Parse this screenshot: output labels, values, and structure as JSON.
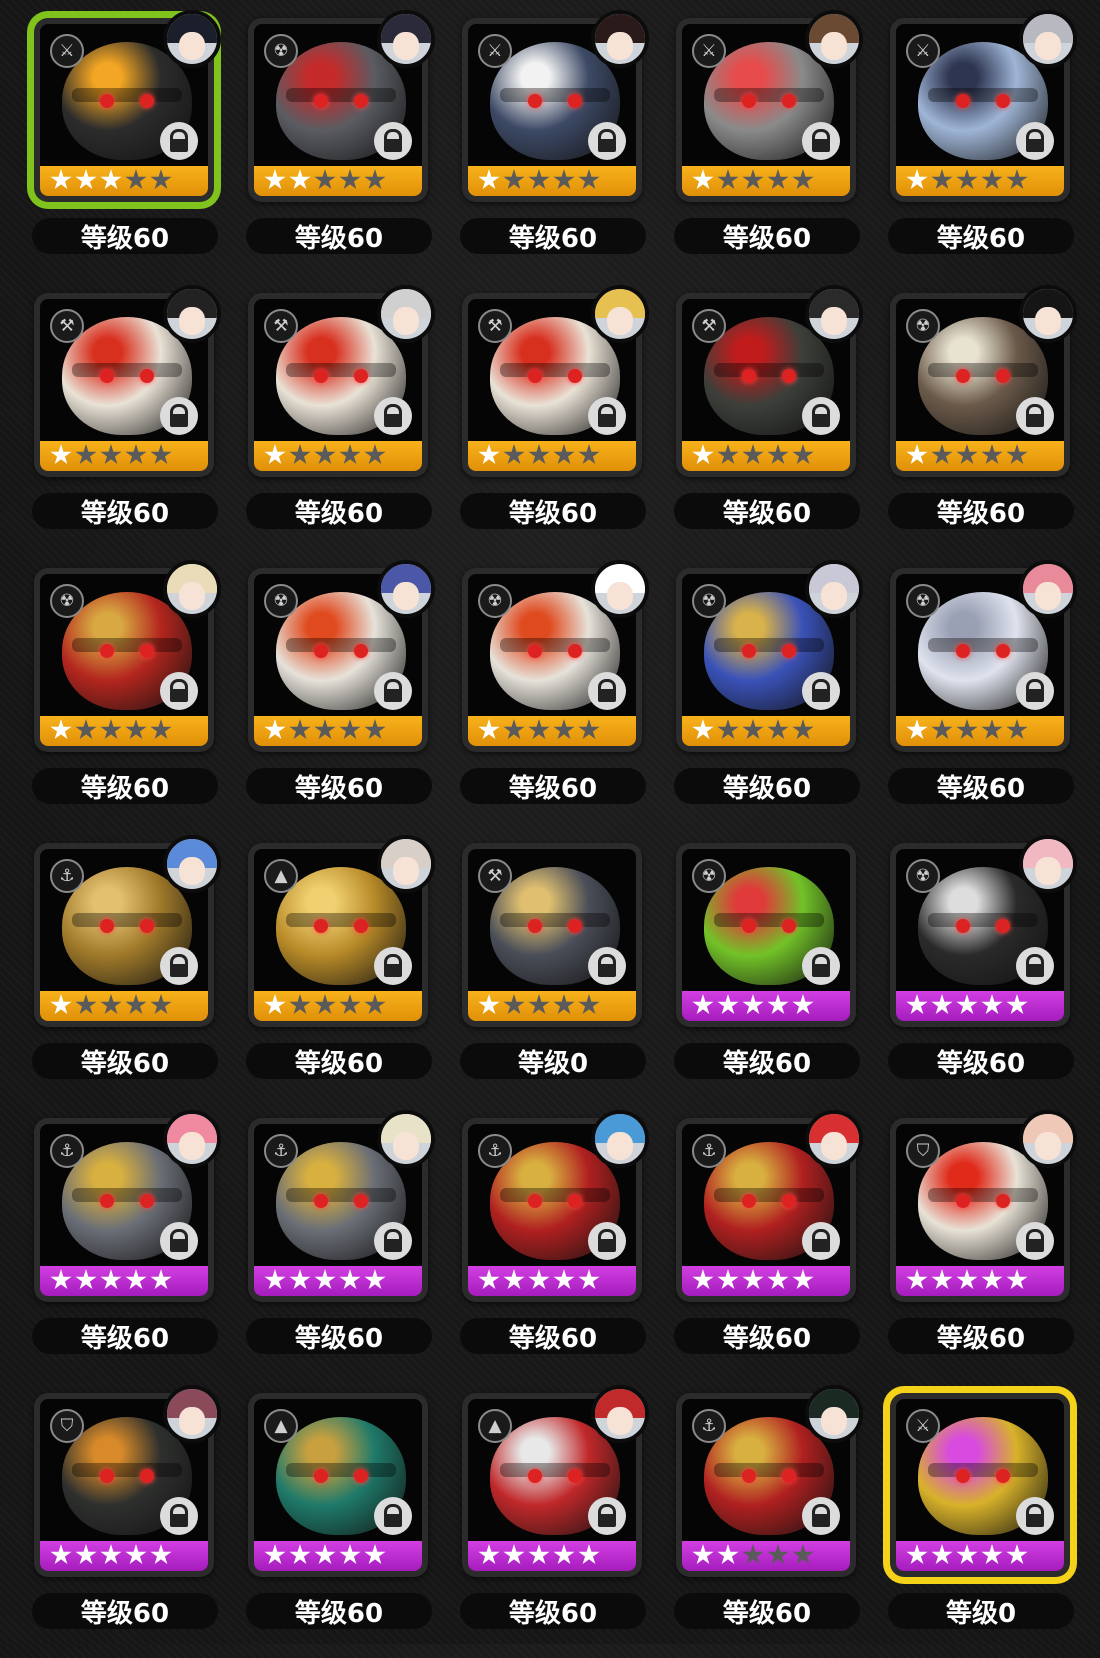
{
  "screen": "bangboo-inventory",
  "colors": {
    "rank_a": "#f8b21b",
    "rank_s": "#d23fe3",
    "selected_green": "#7fc31c",
    "selected_yellow": "#f5d21a",
    "level_pill": "#0b0b0b"
  },
  "bangboos": [
    {
      "level": "等级60",
      "rank": "a",
      "stars": 3,
      "selected": "green",
      "type_icon": "crossed-swords-icon",
      "avatar_hair": "#1b1f2b",
      "body": "#2c2c2c",
      "accent": "#f3a623"
    },
    {
      "level": "等级60",
      "rank": "a",
      "stars": 2,
      "selected": "",
      "type_icon": "radiation-icon",
      "avatar_hair": "#2a2a3a",
      "body": "#5a5c62",
      "accent": "#c52a2a"
    },
    {
      "level": "等级60",
      "rank": "a",
      "stars": 1,
      "selected": "",
      "type_icon": "crossed-swords-icon",
      "avatar_hair": "#2a1a1a",
      "body": "#3d4a66",
      "accent": "#f2f2f2"
    },
    {
      "level": "等级60",
      "rank": "a",
      "stars": 1,
      "selected": "",
      "type_icon": "crossed-swords-icon",
      "avatar_hair": "#6a4a32",
      "body": "#8a8a8a",
      "accent": "#e84b4b"
    },
    {
      "level": "等级60",
      "rank": "a",
      "stars": 1,
      "selected": "",
      "type_icon": "crossed-swords-icon",
      "avatar_hair": "#b8b8c0",
      "body": "#9fb5d6",
      "accent": "#2d3550"
    },
    {
      "level": "等级60",
      "rank": "a",
      "stars": 1,
      "selected": "",
      "type_icon": "hammer-icon",
      "avatar_hair": "#222222",
      "body": "#e9e2d6",
      "accent": "#d8301f"
    },
    {
      "level": "等级60",
      "rank": "a",
      "stars": 1,
      "selected": "",
      "type_icon": "hammer-icon",
      "avatar_hair": "#d0d0d0",
      "body": "#e9e2d6",
      "accent": "#d8301f"
    },
    {
      "level": "等级60",
      "rank": "a",
      "stars": 1,
      "selected": "",
      "type_icon": "hammer-icon",
      "avatar_hair": "#e6c050",
      "body": "#e9e2d6",
      "accent": "#d8301f"
    },
    {
      "level": "等级60",
      "rank": "a",
      "stars": 1,
      "selected": "",
      "type_icon": "hammer-icon",
      "avatar_hair": "#2a2a2a",
      "body": "#3c3f3a",
      "accent": "#c01c1c"
    },
    {
      "level": "等级60",
      "rank": "a",
      "stars": 1,
      "selected": "",
      "type_icon": "radiation-icon",
      "avatar_hair": "#151515",
      "body": "#6b5a4a",
      "accent": "#e8e2d0"
    },
    {
      "level": "等级60",
      "rank": "a",
      "stars": 1,
      "selected": "",
      "type_icon": "radiation-icon",
      "avatar_hair": "#eadcb8",
      "body": "#b3261e",
      "accent": "#d8a842"
    },
    {
      "level": "等级60",
      "rank": "a",
      "stars": 1,
      "selected": "",
      "type_icon": "radiation-icon",
      "avatar_hair": "#4b58a8",
      "body": "#e6e2da",
      "accent": "#e04a1f"
    },
    {
      "level": "等级60",
      "rank": "a",
      "stars": 1,
      "selected": "",
      "type_icon": "radiation-icon",
      "avatar_hair": "#ffffff",
      "body": "#e6e2da",
      "accent": "#e04a1f"
    },
    {
      "level": "等级60",
      "rank": "a",
      "stars": 1,
      "selected": "",
      "type_icon": "radiation-icon",
      "avatar_hair": "#c8c8d6",
      "body": "#3a52b8",
      "accent": "#d8b24a"
    },
    {
      "level": "等级60",
      "rank": "a",
      "stars": 1,
      "selected": "",
      "type_icon": "radiation-icon",
      "avatar_hair": "#e88a9a",
      "body": "#dfe3ee",
      "accent": "#9aa0b4"
    },
    {
      "level": "等级60",
      "rank": "a",
      "stars": 1,
      "selected": "",
      "type_icon": "anchor-icon",
      "avatar_hair": "#5a8ad8",
      "body": "#a07a2a",
      "accent": "#e2c070"
    },
    {
      "level": "等级60",
      "rank": "a",
      "stars": 1,
      "selected": "",
      "type_icon": "triangle-icon",
      "avatar_hair": "#d8d0c8",
      "body": "#b88a28",
      "accent": "#f0d070"
    },
    {
      "level": "等级0",
      "rank": "a",
      "stars": 1,
      "selected": "",
      "type_icon": "hammer-icon",
      "avatar_hair": "",
      "body": "#4a4e58",
      "accent": "#e0c070"
    },
    {
      "level": "等级60",
      "rank": "s",
      "stars": 5,
      "selected": "",
      "type_icon": "radiation-icon",
      "avatar_hair": "",
      "body": "#72c228",
      "accent": "#e03a3a"
    },
    {
      "level": "等级60",
      "rank": "s",
      "stars": 5,
      "selected": "",
      "type_icon": "radiation-icon",
      "avatar_hair": "#f0b8c0",
      "body": "#2a2a2a",
      "accent": "#dddddd"
    },
    {
      "level": "等级60",
      "rank": "s",
      "stars": 5,
      "selected": "",
      "type_icon": "anchor-icon",
      "avatar_hair": "#f08aa0",
      "body": "#6a6e76",
      "accent": "#d8b040"
    },
    {
      "level": "等级60",
      "rank": "s",
      "stars": 5,
      "selected": "",
      "type_icon": "anchor-icon",
      "avatar_hair": "#e8e2c8",
      "body": "#6a6e76",
      "accent": "#d8b040"
    },
    {
      "level": "等级60",
      "rank": "s",
      "stars": 5,
      "selected": "",
      "type_icon": "anchor-icon",
      "avatar_hair": "#4a9ad8",
      "body": "#b02020",
      "accent": "#d8b040"
    },
    {
      "level": "等级60",
      "rank": "s",
      "stars": 5,
      "selected": "",
      "type_icon": "anchor-icon",
      "avatar_hair": "#d83030",
      "body": "#b02020",
      "accent": "#d8b040"
    },
    {
      "level": "等级60",
      "rank": "s",
      "stars": 5,
      "selected": "",
      "type_icon": "shield-icon",
      "avatar_hair": "#f0c8b8",
      "body": "#e8e2d6",
      "accent": "#e02a1a"
    },
    {
      "level": "等级60",
      "rank": "s",
      "stars": 5,
      "selected": "",
      "type_icon": "shield-icon",
      "avatar_hair": "#8a4a5a",
      "body": "#2e302e",
      "accent": "#d88a2a"
    },
    {
      "level": "等级60",
      "rank": "s",
      "stars": 5,
      "selected": "",
      "type_icon": "triangle-icon",
      "avatar_hair": "",
      "body": "#1f7a6a",
      "accent": "#c8a040"
    },
    {
      "level": "等级60",
      "rank": "s",
      "stars": 5,
      "selected": "",
      "type_icon": "triangle-icon",
      "avatar_hair": "#c02a2a",
      "body": "#c0282a",
      "accent": "#e8e8e8"
    },
    {
      "level": "等级60",
      "rank": "s",
      "stars": 2,
      "selected": "",
      "type_icon": "anchor-icon",
      "avatar_hair": "#1a2a22",
      "body": "#b02020",
      "accent": "#d8b040"
    },
    {
      "level": "等级0",
      "rank": "s",
      "stars": 5,
      "selected": "yellow",
      "type_icon": "crossed-swords-icon",
      "avatar_hair": "",
      "body": "#d8b22a",
      "accent": "#d84ae0"
    }
  ]
}
